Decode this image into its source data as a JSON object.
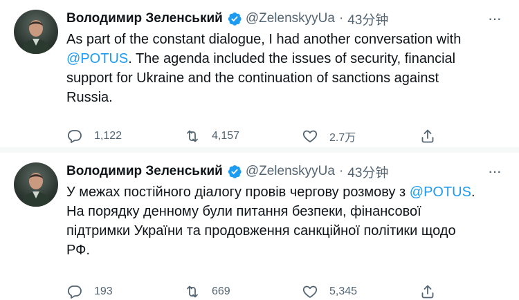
{
  "tweets": [
    {
      "author_name": "Володимир Зеленський",
      "handle": "@ZelenskyyUa",
      "separator": "·",
      "time": "43分钟",
      "text_before": "As part of the constant dialogue, I had another conversation with ",
      "mention": "@POTUS",
      "text_after": ". The agenda included the issues of security, financial support for Ukraine and the continuation of sanctions against Russia.",
      "reply_count": "1,122",
      "retweet_count": "4,157",
      "like_count": "2.7万"
    },
    {
      "author_name": "Володимир Зеленський",
      "handle": "@ZelenskyyUa",
      "separator": "·",
      "time": "43分钟",
      "text_before": "У межах постійного діалогу провів чергову розмову з ",
      "mention": "@POTUS",
      "text_after": ". На порядку денному були питання безпеки, фінансової підтримки України та продовження санкційної політики щодо РФ.",
      "reply_count": "193",
      "retweet_count": "669",
      "like_count": "5,345"
    }
  ],
  "colors": {
    "accent": "#1d9bf0",
    "text": "#0f1419",
    "secondary": "#536471",
    "divider": "#f7f9f9"
  },
  "icons": {
    "more": "more-dots-icon",
    "verified": "verified-badge-icon",
    "reply": "reply-icon",
    "retweet": "retweet-icon",
    "like": "heart-icon",
    "share": "share-icon"
  }
}
